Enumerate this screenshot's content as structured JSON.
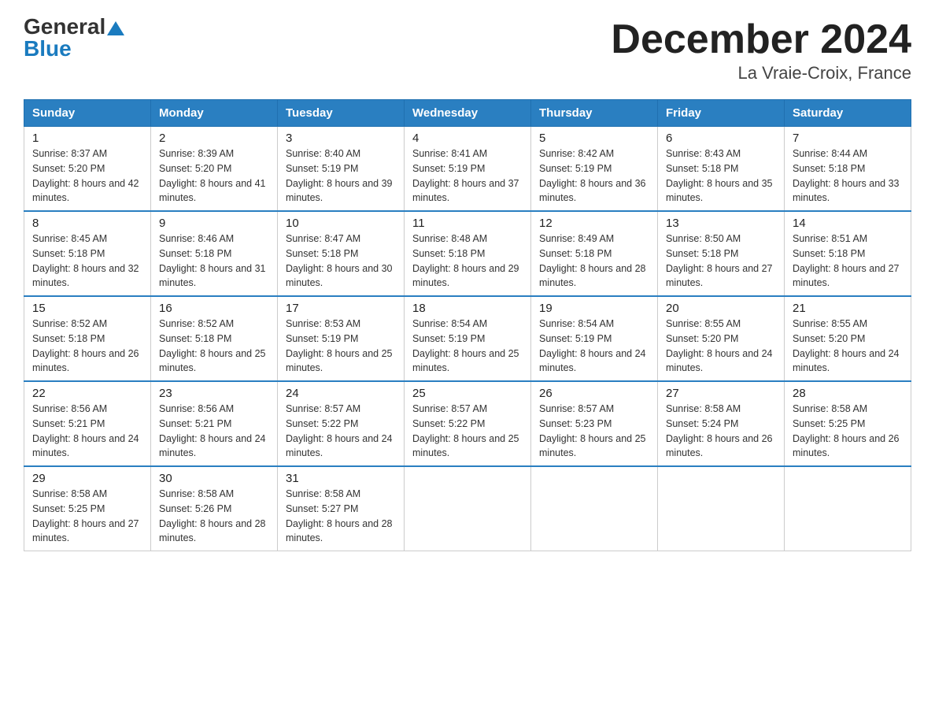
{
  "header": {
    "logo_general": "General",
    "logo_blue": "Blue",
    "month_title": "December 2024",
    "location": "La Vraie-Croix, France"
  },
  "weekdays": [
    "Sunday",
    "Monday",
    "Tuesday",
    "Wednesday",
    "Thursday",
    "Friday",
    "Saturday"
  ],
  "weeks": [
    [
      {
        "day": "1",
        "sunrise": "8:37 AM",
        "sunset": "5:20 PM",
        "daylight": "8 hours and 42 minutes."
      },
      {
        "day": "2",
        "sunrise": "8:39 AM",
        "sunset": "5:20 PM",
        "daylight": "8 hours and 41 minutes."
      },
      {
        "day": "3",
        "sunrise": "8:40 AM",
        "sunset": "5:19 PM",
        "daylight": "8 hours and 39 minutes."
      },
      {
        "day": "4",
        "sunrise": "8:41 AM",
        "sunset": "5:19 PM",
        "daylight": "8 hours and 37 minutes."
      },
      {
        "day": "5",
        "sunrise": "8:42 AM",
        "sunset": "5:19 PM",
        "daylight": "8 hours and 36 minutes."
      },
      {
        "day": "6",
        "sunrise": "8:43 AM",
        "sunset": "5:18 PM",
        "daylight": "8 hours and 35 minutes."
      },
      {
        "day": "7",
        "sunrise": "8:44 AM",
        "sunset": "5:18 PM",
        "daylight": "8 hours and 33 minutes."
      }
    ],
    [
      {
        "day": "8",
        "sunrise": "8:45 AM",
        "sunset": "5:18 PM",
        "daylight": "8 hours and 32 minutes."
      },
      {
        "day": "9",
        "sunrise": "8:46 AM",
        "sunset": "5:18 PM",
        "daylight": "8 hours and 31 minutes."
      },
      {
        "day": "10",
        "sunrise": "8:47 AM",
        "sunset": "5:18 PM",
        "daylight": "8 hours and 30 minutes."
      },
      {
        "day": "11",
        "sunrise": "8:48 AM",
        "sunset": "5:18 PM",
        "daylight": "8 hours and 29 minutes."
      },
      {
        "day": "12",
        "sunrise": "8:49 AM",
        "sunset": "5:18 PM",
        "daylight": "8 hours and 28 minutes."
      },
      {
        "day": "13",
        "sunrise": "8:50 AM",
        "sunset": "5:18 PM",
        "daylight": "8 hours and 27 minutes."
      },
      {
        "day": "14",
        "sunrise": "8:51 AM",
        "sunset": "5:18 PM",
        "daylight": "8 hours and 27 minutes."
      }
    ],
    [
      {
        "day": "15",
        "sunrise": "8:52 AM",
        "sunset": "5:18 PM",
        "daylight": "8 hours and 26 minutes."
      },
      {
        "day": "16",
        "sunrise": "8:52 AM",
        "sunset": "5:18 PM",
        "daylight": "8 hours and 25 minutes."
      },
      {
        "day": "17",
        "sunrise": "8:53 AM",
        "sunset": "5:19 PM",
        "daylight": "8 hours and 25 minutes."
      },
      {
        "day": "18",
        "sunrise": "8:54 AM",
        "sunset": "5:19 PM",
        "daylight": "8 hours and 25 minutes."
      },
      {
        "day": "19",
        "sunrise": "8:54 AM",
        "sunset": "5:19 PM",
        "daylight": "8 hours and 24 minutes."
      },
      {
        "day": "20",
        "sunrise": "8:55 AM",
        "sunset": "5:20 PM",
        "daylight": "8 hours and 24 minutes."
      },
      {
        "day": "21",
        "sunrise": "8:55 AM",
        "sunset": "5:20 PM",
        "daylight": "8 hours and 24 minutes."
      }
    ],
    [
      {
        "day": "22",
        "sunrise": "8:56 AM",
        "sunset": "5:21 PM",
        "daylight": "8 hours and 24 minutes."
      },
      {
        "day": "23",
        "sunrise": "8:56 AM",
        "sunset": "5:21 PM",
        "daylight": "8 hours and 24 minutes."
      },
      {
        "day": "24",
        "sunrise": "8:57 AM",
        "sunset": "5:22 PM",
        "daylight": "8 hours and 24 minutes."
      },
      {
        "day": "25",
        "sunrise": "8:57 AM",
        "sunset": "5:22 PM",
        "daylight": "8 hours and 25 minutes."
      },
      {
        "day": "26",
        "sunrise": "8:57 AM",
        "sunset": "5:23 PM",
        "daylight": "8 hours and 25 minutes."
      },
      {
        "day": "27",
        "sunrise": "8:58 AM",
        "sunset": "5:24 PM",
        "daylight": "8 hours and 26 minutes."
      },
      {
        "day": "28",
        "sunrise": "8:58 AM",
        "sunset": "5:25 PM",
        "daylight": "8 hours and 26 minutes."
      }
    ],
    [
      {
        "day": "29",
        "sunrise": "8:58 AM",
        "sunset": "5:25 PM",
        "daylight": "8 hours and 27 minutes."
      },
      {
        "day": "30",
        "sunrise": "8:58 AM",
        "sunset": "5:26 PM",
        "daylight": "8 hours and 28 minutes."
      },
      {
        "day": "31",
        "sunrise": "8:58 AM",
        "sunset": "5:27 PM",
        "daylight": "8 hours and 28 minutes."
      },
      null,
      null,
      null,
      null
    ]
  ],
  "labels": {
    "sunrise": "Sunrise:",
    "sunset": "Sunset:",
    "daylight": "Daylight:"
  }
}
